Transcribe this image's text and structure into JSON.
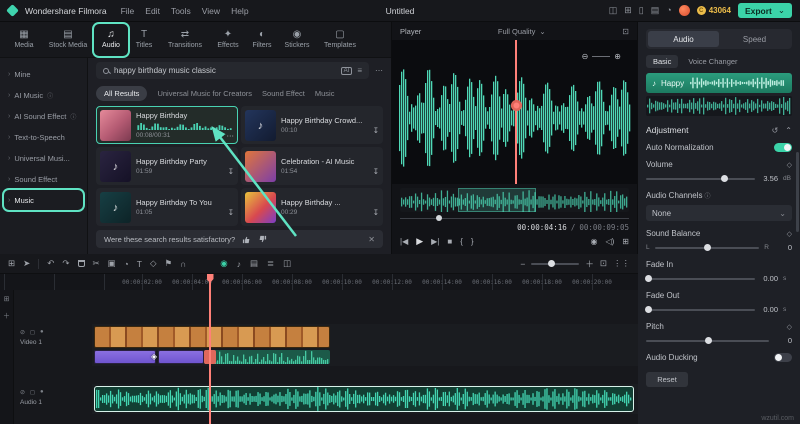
{
  "menubar": {
    "app_name": "Wondershare Filmora",
    "menus": [
      "File",
      "Edit",
      "Tools",
      "View",
      "Help"
    ],
    "project_title": "Untitled",
    "coin_count": "43064",
    "export_label": "Export"
  },
  "media_tabs": [
    {
      "label": "Media"
    },
    {
      "label": "Stock Media"
    },
    {
      "label": "Audio"
    },
    {
      "label": "Titles"
    },
    {
      "label": "Transitions"
    },
    {
      "label": "Effects"
    },
    {
      "label": "Filters"
    },
    {
      "label": "Stickers"
    },
    {
      "label": "Templates"
    }
  ],
  "sidebar": [
    {
      "label": "Mine"
    },
    {
      "label": "AI Music"
    },
    {
      "label": "AI Sound Effect"
    },
    {
      "label": "Text-to-Speech"
    },
    {
      "label": "Universal Musi..."
    },
    {
      "label": "Sound Effect"
    },
    {
      "label": "Music"
    }
  ],
  "search": {
    "query": "happy birthday music classic",
    "ai_badge": "AI"
  },
  "filter_tabs": [
    "All Results",
    "Universal Music for Creators",
    "Sound Effect",
    "Music"
  ],
  "results": [
    {
      "title": "Happy Birthday",
      "time": "00:08/00:31"
    },
    {
      "title": "Happy Birthday Crowd...",
      "time": "00:10"
    },
    {
      "title": "Happy Birthday Party",
      "time": "01:59"
    },
    {
      "title": "Celebration - AI Music",
      "time": "01:54"
    },
    {
      "title": "Happy Birthday To You",
      "time": "01:05"
    },
    {
      "title": "Happy Birthday ...",
      "time": "00:29"
    }
  ],
  "feedback": {
    "question": "Were these search results satisfactory?"
  },
  "player": {
    "label": "Player",
    "quality": "Full Quality",
    "current_time": "00:00:04:16",
    "duration": "00:00:09:05"
  },
  "inspector": {
    "tabs": [
      "Audio",
      "Speed"
    ],
    "subtabs": [
      "Basic",
      "Voice Changer"
    ],
    "clip_name": "Happy",
    "adjustment_title": "Adjustment",
    "auto_normalization_label": "Auto Normalization",
    "volume": {
      "label": "Volume",
      "value": "3.56",
      "unit": "dB"
    },
    "audio_channels": {
      "label": "Audio Channels",
      "value": "None"
    },
    "sound_balance": {
      "label": "Sound Balance",
      "value": "0",
      "left": "L",
      "right": "R"
    },
    "fade_in": {
      "label": "Fade In",
      "value": "0.00",
      "unit": "s"
    },
    "fade_out": {
      "label": "Fade Out",
      "value": "0.00",
      "unit": "s"
    },
    "pitch": {
      "label": "Pitch",
      "value": "0"
    },
    "audio_ducking_label": "Audio Ducking",
    "reset_label": "Reset"
  },
  "timeline": {
    "ruler": [
      "00:00:02:00",
      "00:00:04:00",
      "00:00:06:00",
      "00:00:08:00",
      "00:00:10:00",
      "00:00:12:00",
      "00:00:14:00",
      "00:00:16:00",
      "00:00:18:00",
      "00:00:20:00"
    ],
    "tracks": [
      {
        "name": "Video 1"
      },
      {
        "name": "Audio 1"
      }
    ]
  },
  "accent_color": "#3bd3a8",
  "annotation_color": "#5fe3c3",
  "watermark": "wzutil.com"
}
